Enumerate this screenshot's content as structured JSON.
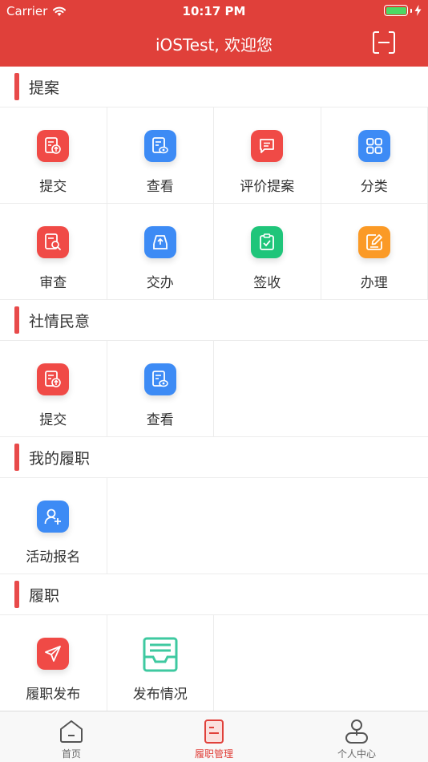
{
  "status_bar": {
    "carrier": "Carrier",
    "time": "10:17 PM"
  },
  "nav": {
    "title": "iOSTest, 欢迎您"
  },
  "sections": [
    {
      "title": "提案",
      "items": [
        {
          "label": "提交",
          "icon": "submit-doc-icon",
          "color": "#f04a46"
        },
        {
          "label": "查看",
          "icon": "view-doc-icon",
          "color": "#3d8bf5"
        },
        {
          "label": "评价提案",
          "icon": "comment-icon",
          "color": "#f04a46"
        },
        {
          "label": "分类",
          "icon": "category-grid-icon",
          "color": "#3d8bf5"
        },
        {
          "label": "审查",
          "icon": "review-search-icon",
          "color": "#f04a46"
        },
        {
          "label": "交办",
          "icon": "upload-tray-icon",
          "color": "#3d8bf5"
        },
        {
          "label": "签收",
          "icon": "clipboard-check-icon",
          "color": "#1fc57a"
        },
        {
          "label": "办理",
          "icon": "edit-pen-icon",
          "color": "#fb9a26"
        }
      ]
    },
    {
      "title": "社情民意",
      "items": [
        {
          "label": "提交",
          "icon": "submit-doc-icon",
          "color": "#f04a46"
        },
        {
          "label": "查看",
          "icon": "view-doc-icon",
          "color": "#3d8bf5"
        }
      ]
    },
    {
      "title": "我的履职",
      "items": [
        {
          "label": "活动报名",
          "icon": "user-add-icon",
          "color": "#3d8bf5"
        }
      ]
    },
    {
      "title": "履职",
      "items": [
        {
          "label": "履职发布",
          "icon": "paper-plane-icon",
          "color": "#f04a46"
        },
        {
          "label": "发布情况",
          "icon": "inbox-tray-icon",
          "color": "#3ec9a0"
        }
      ]
    }
  ],
  "tabbar": [
    {
      "label": "首页",
      "icon": "home-icon"
    },
    {
      "label": "履职管理",
      "icon": "duty-doc-icon",
      "active": true
    },
    {
      "label": "个人中心",
      "icon": "person-icon"
    }
  ]
}
